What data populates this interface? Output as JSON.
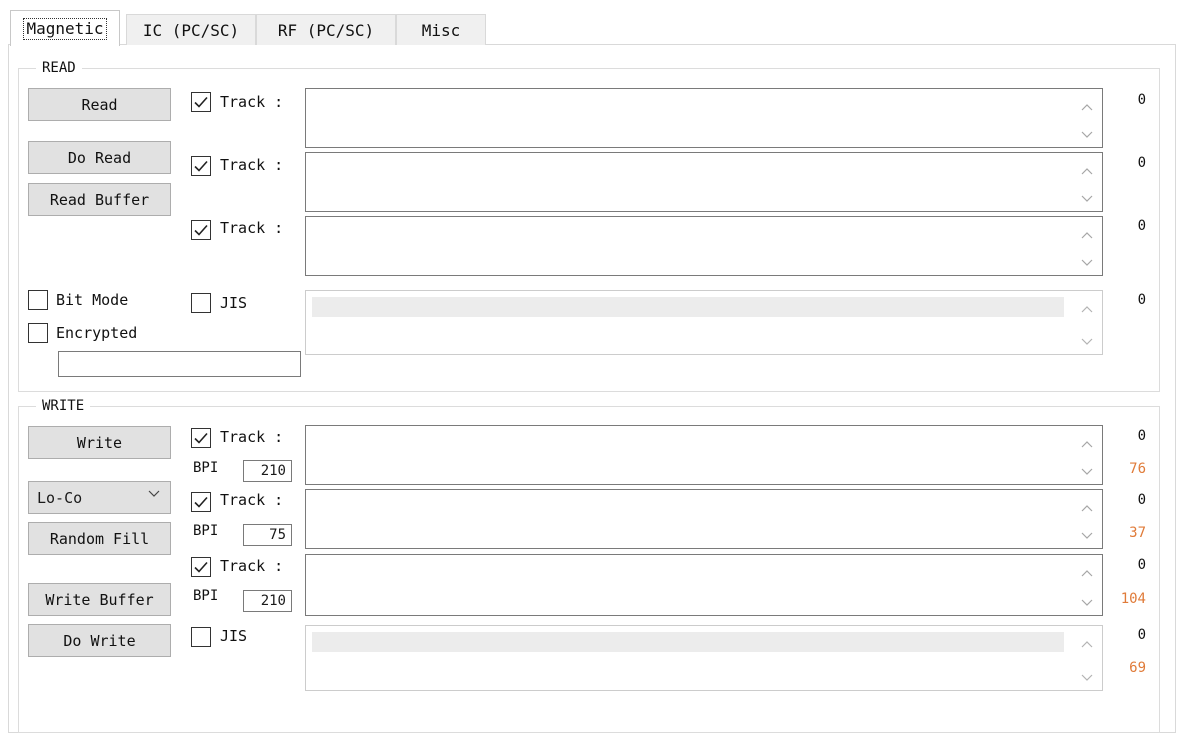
{
  "tabs": [
    "Magnetic",
    "IC (PC/SC)",
    "RF (PC/SC)",
    "Misc"
  ],
  "read": {
    "title": "READ",
    "buttons": {
      "read": "Read",
      "do_read": "Do Read",
      "read_buffer": "Read Buffer"
    },
    "tracks": [
      {
        "label": "Track :",
        "checked": true,
        "value": "",
        "count": "0"
      },
      {
        "label": "Track :",
        "checked": true,
        "value": "",
        "count": "0"
      },
      {
        "label": "Track :",
        "checked": true,
        "value": "",
        "count": "0"
      }
    ],
    "bit_mode_label": "Bit Mode",
    "encrypted_label": "Encrypted",
    "jis_label": "JIS",
    "jis_count": "0",
    "encrypted_value": ""
  },
  "write": {
    "title": "WRITE",
    "buttons": {
      "write": "Write",
      "random_fill": "Random Fill",
      "write_buffer": "Write Buffer",
      "do_write": "Do Write"
    },
    "coercivity": "Lo-Co",
    "bpi_label": "BPI",
    "tracks": [
      {
        "label": "Track :",
        "checked": true,
        "bpi": "210",
        "count": "0",
        "max": "76"
      },
      {
        "label": "Track :",
        "checked": true,
        "bpi": "75",
        "count": "0",
        "max": "37"
      },
      {
        "label": "Track :",
        "checked": true,
        "bpi": "210",
        "count": "0",
        "max": "104"
      }
    ],
    "jis_label": "JIS",
    "jis_count": "0",
    "jis_max": "69"
  },
  "colors": {
    "limit_count": "#e07b39",
    "button_face": "#e1e1e1",
    "border": "#7a7a7a"
  }
}
